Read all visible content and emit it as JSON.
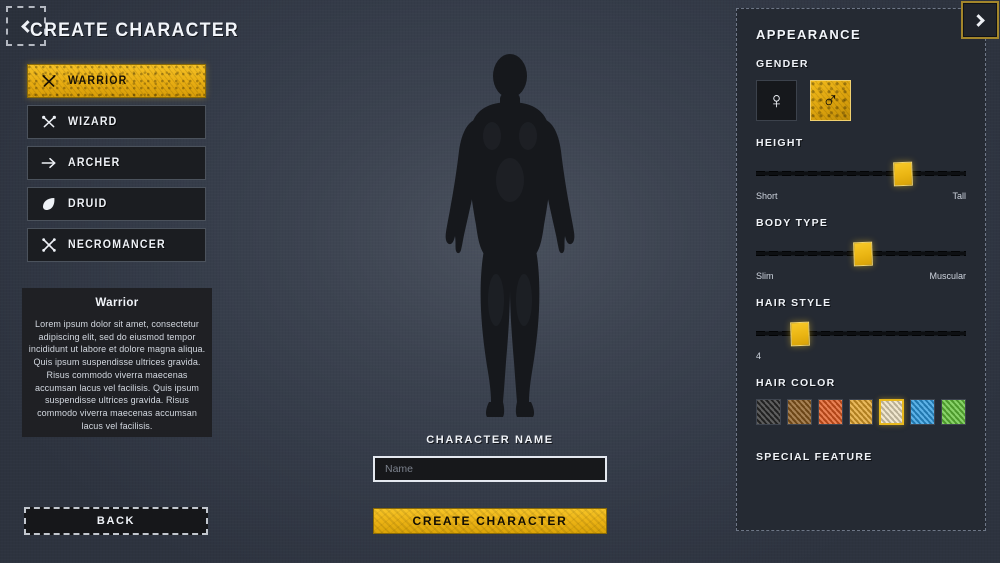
{
  "header": {
    "title": "CREATE CHARACTER",
    "back_arrow_icon": "chevron-left-icon"
  },
  "classes": [
    {
      "id": "warrior",
      "label": "WARRIOR",
      "icon": "crossed-swords-icon",
      "selected": true
    },
    {
      "id": "wizard",
      "label": "WIZARD",
      "icon": "crossed-wands-icon",
      "selected": false
    },
    {
      "id": "archer",
      "label": "ARCHER",
      "icon": "arrow-icon",
      "selected": false
    },
    {
      "id": "druid",
      "label": "DRUID",
      "icon": "leaf-icon",
      "selected": false
    },
    {
      "id": "necromancer",
      "label": "NECROMANCER",
      "icon": "crossed-bones-icon",
      "selected": false
    }
  ],
  "description": {
    "title": "Warrior",
    "body": "Lorem ipsum dolor sit amet, consectetur adipiscing elit, sed do eiusmod tempor incididunt ut labore et dolore magna aliqua. Quis ipsum suspendisse ultrices gravida. Risus commodo viverra maecenas accumsan lacus vel facilisis. Quis ipsum suspendisse ultrices gravida. Risus commodo viverra maecenas accumsan lacus vel facilisis."
  },
  "back_button": {
    "label": "BACK"
  },
  "character": {
    "silhouette_name": "character-silhouette",
    "pose": "standing-idle"
  },
  "name_section": {
    "label": "CHARACTER NAME",
    "value": "",
    "placeholder": "Name"
  },
  "create_button": {
    "label": "CREATE CHARACTER"
  },
  "appearance": {
    "title": "APPEARANCE",
    "next_arrow_icon": "chevron-right-icon",
    "gender": {
      "label": "GENDER",
      "options": [
        {
          "id": "female",
          "icon": "venus-icon",
          "glyph": "♀",
          "selected": false
        },
        {
          "id": "male",
          "icon": "mars-icon",
          "glyph": "♂",
          "selected": true
        }
      ]
    },
    "height": {
      "label": "HEIGHT",
      "min_label": "Short",
      "max_label": "Tall",
      "percent": 70
    },
    "body_type": {
      "label": "BODY TYPE",
      "min_label": "Slim",
      "max_label": "Muscular",
      "percent": 51
    },
    "hair_style": {
      "label": "HAIR STYLE",
      "value_label": "4",
      "percent": 21
    },
    "hair_color": {
      "label": "HAIR COLOR",
      "swatches": [
        {
          "id": "black",
          "color": "#2b2b2b",
          "selected": false
        },
        {
          "id": "brown",
          "color": "#8a5a1e",
          "selected": false
        },
        {
          "id": "ginger",
          "color": "#e2591f",
          "selected": false
        },
        {
          "id": "gold",
          "color": "#e2a32a",
          "selected": false
        },
        {
          "id": "blonde",
          "color": "#ede0c0",
          "selected": true
        },
        {
          "id": "blue",
          "color": "#2b9ae0",
          "selected": false
        },
        {
          "id": "green",
          "color": "#63c43a",
          "selected": false
        }
      ]
    },
    "special_feature": {
      "label": "SPECIAL FEATURE"
    }
  },
  "theme": {
    "accent": "#eab513",
    "background": "#333a47",
    "panel": "#252a33",
    "text": "#f0f3f8"
  }
}
